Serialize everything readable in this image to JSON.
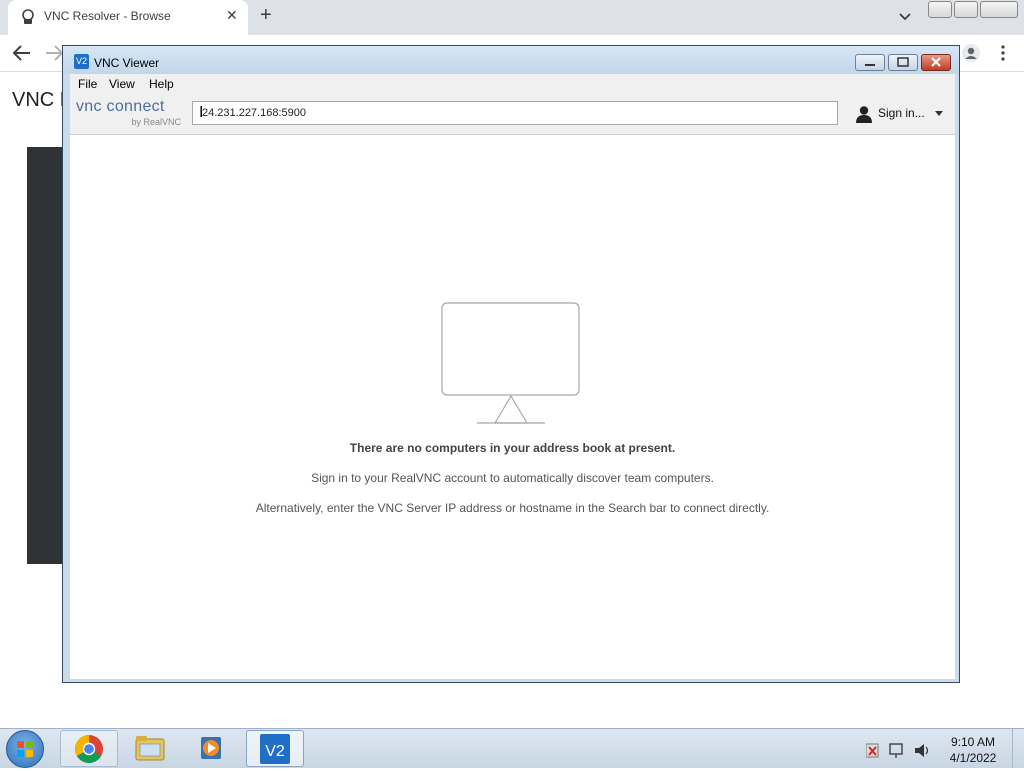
{
  "browser": {
    "tab_title": "VNC Resolver - Browse",
    "tab_close": "✕",
    "new_tab": "+",
    "page_heading": "VNC R"
  },
  "vnc": {
    "window_title": "VNC Viewer",
    "title_icon_text": "V2",
    "menu": {
      "file": "File",
      "view": "View",
      "help": "Help"
    },
    "logo": {
      "text": "vnc connect",
      "byline": "by RealVNC"
    },
    "address_value": "24.231.227.168:5900",
    "signin_label": "Sign in...",
    "empty_title": "There are no computers in your address book at present.",
    "empty_signin": "Sign in to your RealVNC account to automatically discover team computers.",
    "empty_alt": "Alternatively, enter the VNC Server IP address or hostname in the Search bar to connect directly."
  },
  "taskbar": {
    "clock_time": "9:10 AM",
    "clock_date": "4/1/2022"
  },
  "icons": {
    "tab_favicon": "vnc-resolver-icon",
    "back": "arrow-left-icon",
    "forward": "arrow-right-icon",
    "profile": "person-icon",
    "menu": "kebab-menu-icon",
    "monitor": "monitor-icon",
    "user": "user-avatar-icon"
  },
  "colors": {
    "vnc_accent": "#1f6fc7",
    "vnc_logo": "#4a6fa0",
    "window_frame": "#c9dcee"
  }
}
